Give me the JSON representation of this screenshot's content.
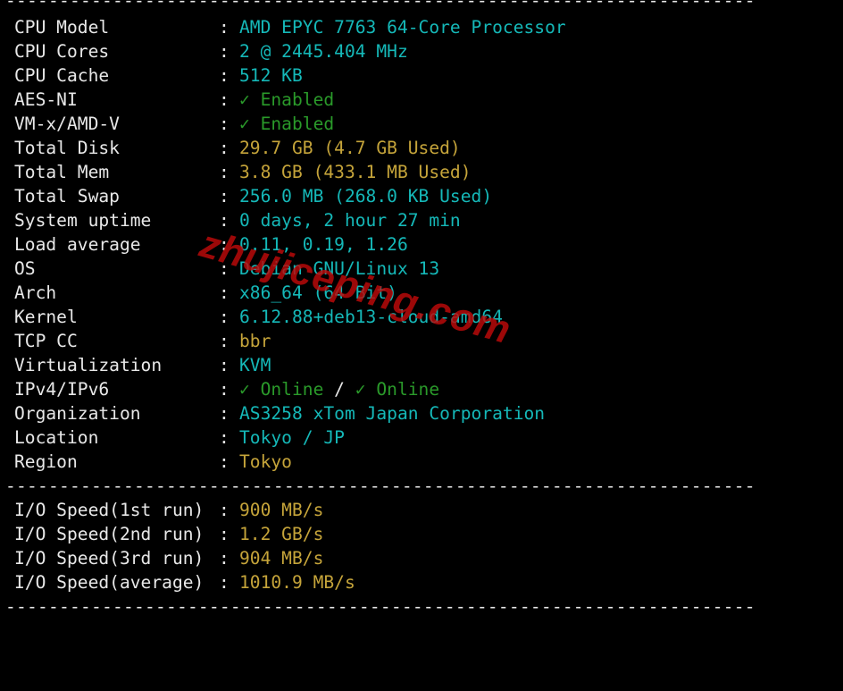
{
  "separator": "----------------------------------------------------------------------",
  "rows": [
    {
      "label": "CPU Model",
      "value": "AMD EPYC 7763 64-Core Processor"
    },
    {
      "label": "CPU Cores",
      "value": "2 @ 2445.404 MHz"
    },
    {
      "label": "CPU Cache",
      "value": "512 KB"
    },
    {
      "label": "AES-NI",
      "value": "✓ Enabled"
    },
    {
      "label": "VM-x/AMD-V",
      "value": "✓ Enabled"
    },
    {
      "label": "Total Disk",
      "value": "29.7 GB (4.7 GB Used)"
    },
    {
      "label": "Total Mem",
      "value": "3.8 GB (433.1 MB Used)"
    },
    {
      "label": "Total Swap",
      "value": "256.0 MB (268.0 KB Used)"
    },
    {
      "label": "System uptime",
      "value": "0 days, 2 hour 27 min"
    },
    {
      "label": "Load average",
      "value": "0.11, 0.19, 1.26"
    },
    {
      "label": "OS",
      "value": "Debian GNU/Linux 13"
    },
    {
      "label": "Arch",
      "value": "x86_64 (64 Bit)"
    },
    {
      "label": "Kernel",
      "value": "6.12.88+deb13-cloud-amd64"
    },
    {
      "label": "TCP CC",
      "value": "bbr"
    },
    {
      "label": "Virtualization",
      "value": "KVM"
    },
    {
      "label": "IPv4/IPv6",
      "value_ipv4": "✓ Online",
      "value_slash": " / ",
      "value_ipv6": "✓ Online"
    },
    {
      "label": "Organization",
      "value": "AS3258 xTom Japan Corporation"
    },
    {
      "label": "Location",
      "value": "Tokyo / JP"
    },
    {
      "label": "Region",
      "value": "Tokyo"
    }
  ],
  "io": [
    {
      "label": "I/O Speed(1st run)",
      "value": "900 MB/s"
    },
    {
      "label": "I/O Speed(2nd run)",
      "value": "1.2 GB/s"
    },
    {
      "label": "I/O Speed(3rd run)",
      "value": "904 MB/s"
    },
    {
      "label": "I/O Speed(average)",
      "value": "1010.9 MB/s"
    }
  ],
  "colon": ":",
  "watermark": "zhujiceping.com",
  "colors": {
    "background": "#000000",
    "label": "#e8e8e8",
    "cyan": "#15b8b8",
    "yellow": "#c5a43a",
    "green": "#2a9a2a",
    "watermark": "#be0a0a"
  }
}
